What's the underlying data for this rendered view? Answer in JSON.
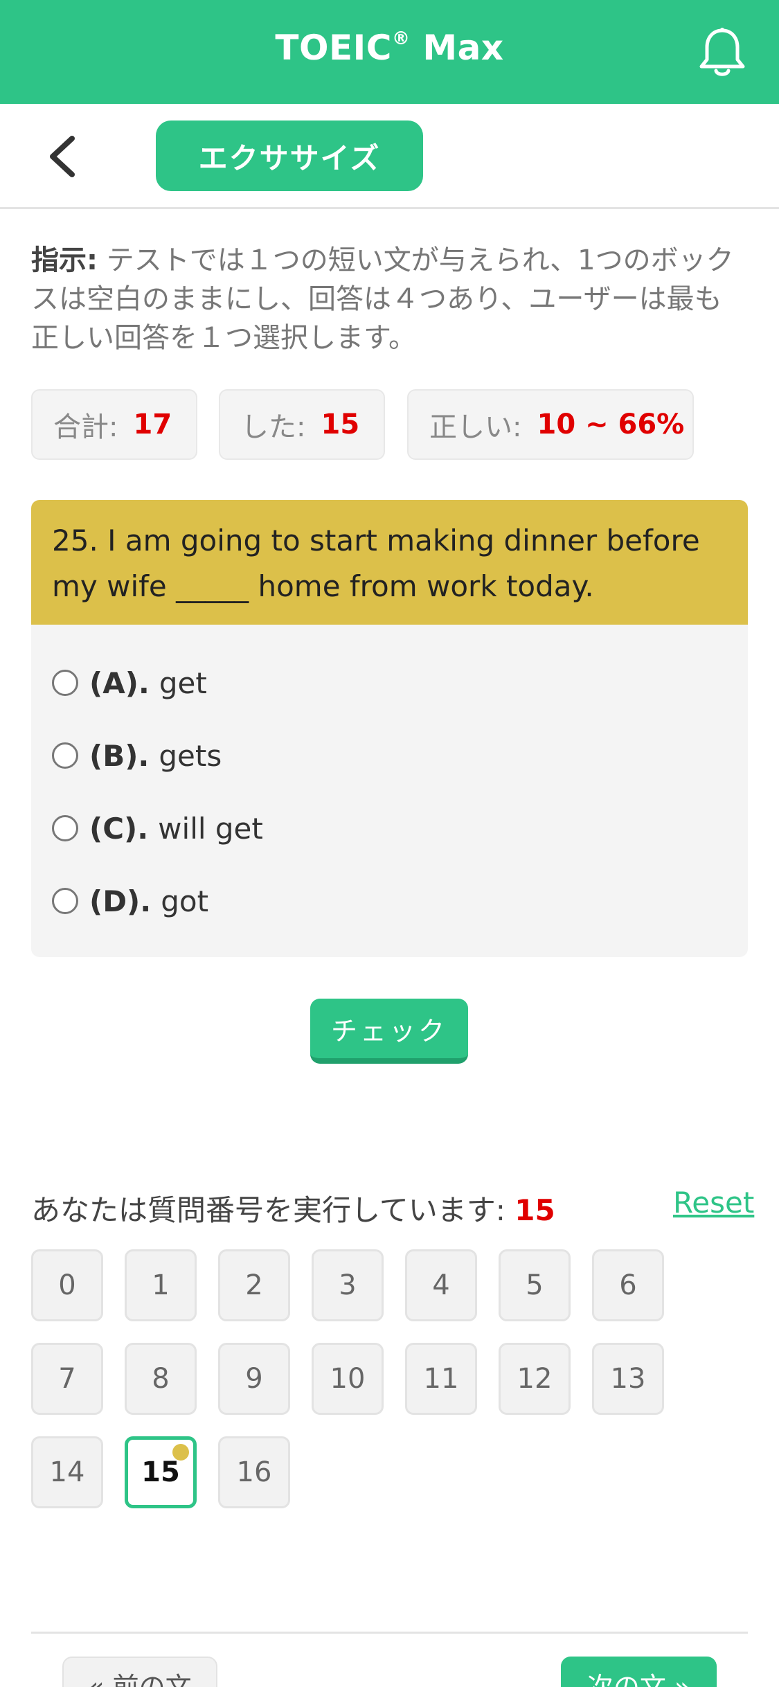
{
  "header": {
    "title": "TOEIC",
    "title_reg": "®",
    "title_suffix": " Max"
  },
  "subbar": {
    "tab_label": "エクササイズ"
  },
  "instruction": {
    "label": "指示:",
    "text": " テストでは１つの短い文が与えられ、1つのボックスは空白のままにし、回答は４つあり、ユーザーは最も正しい回答を１つ選択します。"
  },
  "stats": [
    {
      "label": "合計:",
      "value": "17"
    },
    {
      "label": "した:",
      "value": "15"
    },
    {
      "label": "正しい:",
      "value": "10 ~ 66%"
    }
  ],
  "question": {
    "text": "25. I am going to start making dinner before my wife _____ home from work today."
  },
  "answers": [
    {
      "key": "(A).",
      "text": "get"
    },
    {
      "key": "(B).",
      "text": "gets"
    },
    {
      "key": "(C).",
      "text": "will get"
    },
    {
      "key": "(D).",
      "text": "got"
    }
  ],
  "check_label": "チェック",
  "progress": {
    "label": "あなたは質問番号を実行しています:",
    "current": "15",
    "reset_label": "Reset"
  },
  "numbers": [
    "0",
    "1",
    "2",
    "3",
    "4",
    "5",
    "6",
    "7",
    "8",
    "9",
    "10",
    "11",
    "12",
    "13",
    "14",
    "15",
    "16"
  ],
  "nav": {
    "prev_label": "« 前の文",
    "next_label": "次の文 »"
  },
  "colors": {
    "brand": "#2ec487",
    "question_bg": "#dcc04a",
    "highlight": "#e00000"
  },
  "icons": {
    "bell": "bell-icon",
    "back": "chevron-left-icon"
  }
}
